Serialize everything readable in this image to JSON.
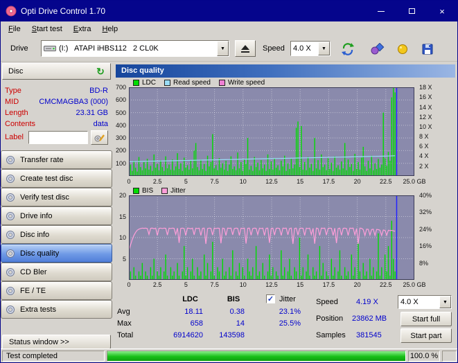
{
  "window": {
    "title": "Opti Drive Control 1.70"
  },
  "icons": {
    "close": "×",
    "dropdown": "▼",
    "check": "✓",
    "refresh": "↻"
  },
  "menu": {
    "items": [
      "File",
      "Start test",
      "Extra",
      "Help"
    ]
  },
  "toolbar": {
    "drive_label": "Drive",
    "drive_value": "(I:)   ATAPI iHBS112   2 CL0K",
    "speed_label": "Speed",
    "speed_value": "4.0 X"
  },
  "sidebar": {
    "disc_header": "Disc",
    "info": [
      {
        "label": "Type",
        "value": "BD-R"
      },
      {
        "label": "MID",
        "value": "CMCMAGBA3 (000)"
      },
      {
        "label": "Length",
        "value": "23.31 GB"
      },
      {
        "label": "Contents",
        "value": "data"
      }
    ],
    "label_field": {
      "label": "Label",
      "value": ""
    },
    "nav": [
      {
        "label": "Transfer rate"
      },
      {
        "label": "Create test disc"
      },
      {
        "label": "Verify test disc"
      },
      {
        "label": "Drive info"
      },
      {
        "label": "Disc info"
      },
      {
        "label": "Disc quality",
        "active": true
      },
      {
        "label": "CD Bler"
      },
      {
        "label": "FE / TE"
      },
      {
        "label": "Extra tests"
      }
    ],
    "status_window": "Status window >>"
  },
  "main": {
    "header": "Disc quality",
    "legend1": [
      "LDC",
      "Read speed",
      "Write speed"
    ],
    "legend2": [
      "BIS",
      "Jitter"
    ]
  },
  "stats": {
    "col_headers": [
      "LDC",
      "BIS"
    ],
    "jitter_label": "Jitter",
    "rows": [
      {
        "label": "Avg",
        "ldc": "18.11",
        "bis": "0.38",
        "jitter": "23.1%"
      },
      {
        "label": "Max",
        "ldc": "658",
        "bis": "14",
        "jitter": "25.5%"
      },
      {
        "label": "Total",
        "ldc": "6914620",
        "bis": "143598",
        "jitter": ""
      }
    ],
    "speed_label": "Speed",
    "speed_value": "4.19 X",
    "speed_combo": "4.0 X",
    "position_label": "Position",
    "position_value": "23862 MB",
    "samples_label": "Samples",
    "samples_value": "381545",
    "start_full": "Start full",
    "start_part": "Start part"
  },
  "statusbar": {
    "status": "Test completed",
    "progress": "100.0 %",
    "progress_pct": 100
  },
  "colors": {
    "plot_bg": "#8a8aac",
    "grid": "#ffffff",
    "ldc": "#00dc00",
    "bis": "#00dc00",
    "read": "#9adcf5",
    "write": "#ef7fd3",
    "jitter": "#ff9ed9",
    "marker": "#2323ff"
  },
  "chart_data": [
    {
      "id": "chart1",
      "type": "bar",
      "title": "LDC errors with read/write speed",
      "x_max": 25,
      "data_end": 23.31,
      "marker_x": 23.45,
      "x_ticks": [
        0,
        2.5,
        5,
        7.5,
        10,
        12.5,
        15,
        17.5,
        20,
        22.5,
        25
      ],
      "x_tick_labels": [
        "0",
        "2.5",
        "5",
        "7.5",
        "10",
        "12.5",
        "15",
        "17.5",
        "20",
        "22.5",
        "25.0 GB"
      ],
      "left_max": 700,
      "left_ticks": [
        100,
        200,
        300,
        400,
        500,
        600,
        700
      ],
      "right_ticks": [
        {
          "label": "18 X",
          "left": 700
        },
        {
          "label": "16 X",
          "left": 622
        },
        {
          "label": "14 X",
          "left": 544
        },
        {
          "label": "12 X",
          "left": 467
        },
        {
          "label": "10 X",
          "left": 389
        },
        {
          "label": "8 X",
          "left": 311
        },
        {
          "label": "6 X",
          "left": 233
        },
        {
          "label": "4 X",
          "left": 156
        },
        {
          "label": "2 X",
          "left": 78
        }
      ],
      "bars": {
        "name": "LDC",
        "color": "ldc",
        "values": [
          55,
          90,
          40,
          120,
          65,
          35,
          150,
          70,
          45,
          110,
          60,
          135,
          50,
          80,
          40,
          170,
          65,
          95,
          45,
          125,
          70,
          40,
          155,
          60,
          90,
          50,
          130,
          45,
          75,
          180,
          55,
          100,
          40,
          145,
          65,
          85,
          50,
          120,
          60,
          200,
          260,
          70,
          45,
          130,
          55,
          95,
          40,
          160,
          75,
          110,
          330,
          60,
          85,
          45,
          140,
          65,
          100,
          50,
          120,
          40,
          90,
          155,
          55,
          75,
          45,
          185,
          60,
          110,
          40,
          130,
          95,
          300,
          50,
          80,
          40,
          150,
          70,
          105,
          45,
          125,
          60,
          90,
          40,
          170,
          55,
          115,
          50,
          140,
          65,
          85,
          45,
          120,
          75,
          160,
          40,
          100,
          55,
          135,
          60,
          90,
          380,
          430,
          70,
          395,
          50,
          110,
          45,
          150,
          65,
          95,
          40,
          300,
          60,
          125,
          50,
          170,
          70,
          90,
          45,
          140,
          55,
          105,
          40,
          155,
          65,
          85,
          50,
          115,
          60,
          260,
          45,
          130,
          70,
          95,
          40,
          175,
          55,
          110,
          50,
          145,
          230,
          75,
          40,
          120,
          60,
          160,
          45,
          100,
          55,
          135,
          65,
          90,
          500,
          140,
          80,
          190,
          120,
          620,
          700,
          660
        ]
      },
      "lines": [
        {
          "name": "Read speed",
          "color": "read",
          "right_max": 18,
          "values": [
            2.9,
            2.93,
            2.96,
            2.99,
            3.02,
            3.05,
            3.08,
            3.11,
            3.14,
            3.17,
            3.2,
            3.23,
            3.26,
            3.29,
            3.32,
            3.35,
            3.38,
            3.41,
            3.44,
            3.47,
            3.5,
            3.53,
            3.56,
            3.59,
            3.62,
            3.65,
            3.68,
            3.71,
            3.74,
            3.77,
            3.8,
            3.83,
            3.86,
            3.89,
            3.92,
            3.95,
            3.98,
            4.01,
            4.05,
            4.1
          ]
        },
        {
          "name": "Write speed",
          "color": "write",
          "right_max": 18,
          "values": []
        }
      ]
    },
    {
      "id": "chart2",
      "type": "bar",
      "title": "BIS errors with jitter",
      "x_max": 25,
      "data_end": 23.31,
      "marker_x": 23.45,
      "x_ticks": [
        0,
        2.5,
        5,
        7.5,
        10,
        12.5,
        15,
        17.5,
        20,
        22.5,
        25
      ],
      "x_tick_labels": [
        "0",
        "2.5",
        "5",
        "7.5",
        "10",
        "12.5",
        "15",
        "17.5",
        "20",
        "22.5",
        "25.0 GB"
      ],
      "left_max": 20,
      "left_ticks": [
        5,
        10,
        15,
        20
      ],
      "right_ticks": [
        {
          "label": "40%",
          "left": 20
        },
        {
          "label": "32%",
          "left": 16
        },
        {
          "label": "24%",
          "left": 12
        },
        {
          "label": "16%",
          "left": 8
        },
        {
          "label": "8%",
          "left": 4
        }
      ],
      "bars": {
        "name": "BIS",
        "color": "bis",
        "values": [
          1,
          2,
          0,
          3,
          1,
          0,
          2,
          1,
          4,
          0,
          2,
          1,
          0,
          3,
          1,
          5,
          0,
          2,
          1,
          3,
          0,
          2,
          6,
          1,
          0,
          3,
          1,
          2,
          0,
          4,
          1,
          0,
          2,
          8,
          1,
          3,
          0,
          2,
          5,
          1,
          0,
          3,
          1,
          2,
          0,
          6,
          1,
          4,
          0,
          2,
          9,
          1,
          0,
          3,
          2,
          0,
          5,
          1,
          2,
          0,
          3,
          1,
          7,
          0,
          2,
          1,
          4,
          0,
          3,
          1,
          0,
          5,
          2,
          1,
          3,
          0,
          8,
          1,
          2,
          0,
          4,
          1,
          0,
          2,
          6,
          1,
          3,
          0,
          2,
          1,
          0,
          7,
          1,
          3,
          0,
          2,
          5,
          1,
          0,
          3,
          2,
          0,
          10,
          1,
          3,
          0,
          2,
          6,
          1,
          0,
          3,
          1,
          2,
          0,
          8,
          1,
          4,
          0,
          2,
          1,
          0,
          5,
          1,
          3,
          0,
          2,
          7,
          1,
          0,
          3,
          1,
          2,
          0,
          6,
          1,
          3,
          0,
          9,
          2,
          0,
          4,
          1,
          2,
          0,
          5,
          1,
          3,
          0,
          2,
          11,
          1,
          3,
          0,
          6,
          2,
          8,
          1,
          14,
          5,
          2
        ]
      },
      "lines": [
        {
          "name": "Jitter",
          "color": "jitter",
          "right_max": 40,
          "values": [
            14.0,
            16.5,
            19.0,
            21.0,
            22.5,
            23.5,
            24.0,
            24.3,
            24.5,
            24.4,
            24.5,
            24.3,
            21.5,
            24.4,
            24.5,
            24.2,
            24.5,
            21.0,
            24.4,
            24.5,
            24.3,
            24.5,
            24.4,
            21.2,
            24.5,
            24.3,
            24.5,
            24.4,
            21.5,
            24.5,
            17.5,
            24.4,
            24.5,
            24.3,
            21.0,
            24.5,
            24.4,
            24.2,
            24.5,
            21.3,
            24.5,
            24.3,
            24.5,
            21.0,
            24.4,
            24.5,
            17.0,
            24.3,
            24.5,
            24.4,
            21.2,
            24.5,
            24.3,
            24.5,
            24.4,
            17.3,
            24.5,
            24.3,
            21.0,
            24.5,
            24.4,
            24.5,
            21.3,
            24.3,
            24.5,
            24.4,
            21.0,
            24.5,
            24.3,
            24.5,
            17.2,
            24.4,
            24.5,
            21.1,
            24.3,
            24.5,
            24.4,
            21.4,
            24.5,
            24.3,
            24.5,
            21.0,
            24.4,
            24.5,
            17.5,
            24.3,
            24.5,
            21.2,
            24.4,
            24.5,
            24.3,
            21.0,
            24.5,
            24.4,
            24.5,
            21.3,
            24.3,
            24.5,
            17.0,
            24.4,
            24.5,
            21.2,
            24.3,
            24.5,
            24.4,
            21.0,
            24.5,
            24.3,
            24.5,
            21.4,
            24.4,
            17.1,
            24.5,
            24.3,
            21.0,
            24.5,
            24.4,
            24.5,
            21.2,
            24.3,
            24.5,
            24.4,
            21.0,
            24.5,
            17.4,
            24.3,
            24.5,
            21.1,
            24.4,
            24.5,
            24.3,
            21.0,
            24.5,
            24.4,
            24.5,
            21.3,
            24.3,
            17.0,
            24.5,
            24.4,
            23.8,
            21.0,
            24.0,
            23.9,
            21.2,
            23.8,
            24.0,
            21.0,
            23.9,
            23.8,
            23.5,
            21.0,
            23.6,
            23.4,
            21.1,
            23.5,
            23.3,
            23.4,
            23.2,
            23.0
          ]
        }
      ]
    }
  ]
}
